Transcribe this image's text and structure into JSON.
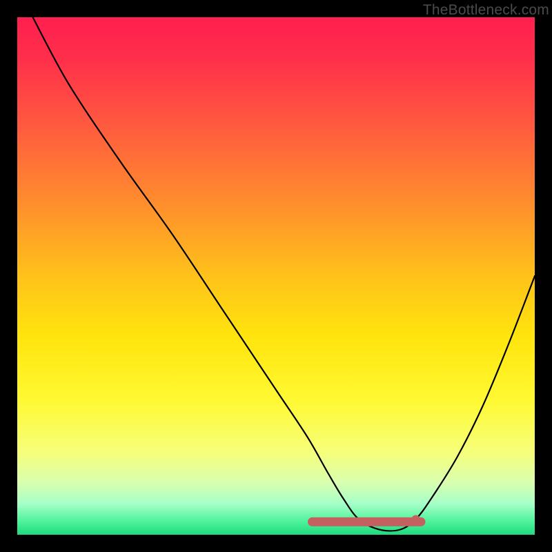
{
  "attribution": "TheBottleneck.com",
  "chart_data": {
    "type": "line",
    "title": "",
    "xlabel": "",
    "ylabel": "",
    "xlim": [
      0,
      100
    ],
    "ylim": [
      0,
      100
    ],
    "x": [
      3,
      10,
      20,
      30,
      40,
      50,
      56,
      60,
      63,
      66,
      70,
      74,
      77,
      80,
      85,
      90,
      95,
      100
    ],
    "values": [
      100,
      87,
      72,
      58,
      43,
      28,
      19,
      12,
      7,
      3,
      1,
      1,
      3,
      7,
      15,
      25,
      37,
      50
    ],
    "flat_region": {
      "x_start": 57,
      "x_end": 78,
      "y": 2.5,
      "color": "#c46060",
      "marker_x": 77,
      "marker_y": 3.0
    },
    "gradient_stops": [
      {
        "offset": 0.0,
        "color": "#ff1f4f"
      },
      {
        "offset": 0.08,
        "color": "#ff2f4b"
      },
      {
        "offset": 0.2,
        "color": "#ff5740"
      },
      {
        "offset": 0.35,
        "color": "#ff8a2e"
      },
      {
        "offset": 0.5,
        "color": "#ffc21a"
      },
      {
        "offset": 0.62,
        "color": "#ffe50d"
      },
      {
        "offset": 0.74,
        "color": "#fff933"
      },
      {
        "offset": 0.84,
        "color": "#f6ff7a"
      },
      {
        "offset": 0.9,
        "color": "#d8ffb0"
      },
      {
        "offset": 0.94,
        "color": "#a6ffc8"
      },
      {
        "offset": 0.975,
        "color": "#4cf29a"
      },
      {
        "offset": 1.0,
        "color": "#1fd97e"
      }
    ]
  }
}
